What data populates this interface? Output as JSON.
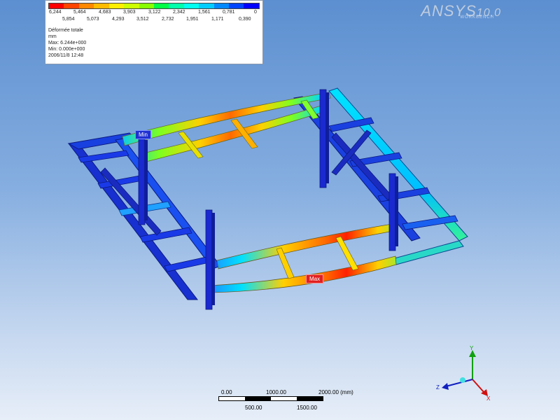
{
  "legend": {
    "top_values": [
      "6,244",
      "5,464",
      "4,683",
      "3,903",
      "3,122",
      "2,342",
      "1,561",
      "0,781",
      "0"
    ],
    "bottom_values": [
      "5,854",
      "5,073",
      "4,293",
      "3,512",
      "2,732",
      "1,951",
      "1,171",
      "0,390"
    ],
    "colors": [
      "#ff0000",
      "#ff4400",
      "#ff8800",
      "#ffbb00",
      "#ffee00",
      "#ccff00",
      "#88ff00",
      "#00ff44",
      "#00ffaa",
      "#00ffee",
      "#00ccff",
      "#0088ff",
      "#0044ff",
      "#0000ff"
    ],
    "title": "Déformée totale",
    "unit": "mm",
    "max": "Max: 6.244e+000",
    "min": "Min: 0.000e+000",
    "date": "2006/11/8 12:48"
  },
  "logo": {
    "brand": "ANSYS",
    "version": "10.0",
    "sub": "WORKBENCH"
  },
  "tags": {
    "min": "Min",
    "max": "Max"
  },
  "scale": {
    "top_labels": [
      "0.00",
      "1000.00",
      "2000.00 (mm)"
    ],
    "bottom_labels": [
      "500.00",
      "1500.00"
    ]
  },
  "triad": {
    "x": "X",
    "y": "Y",
    "z": "Z"
  }
}
